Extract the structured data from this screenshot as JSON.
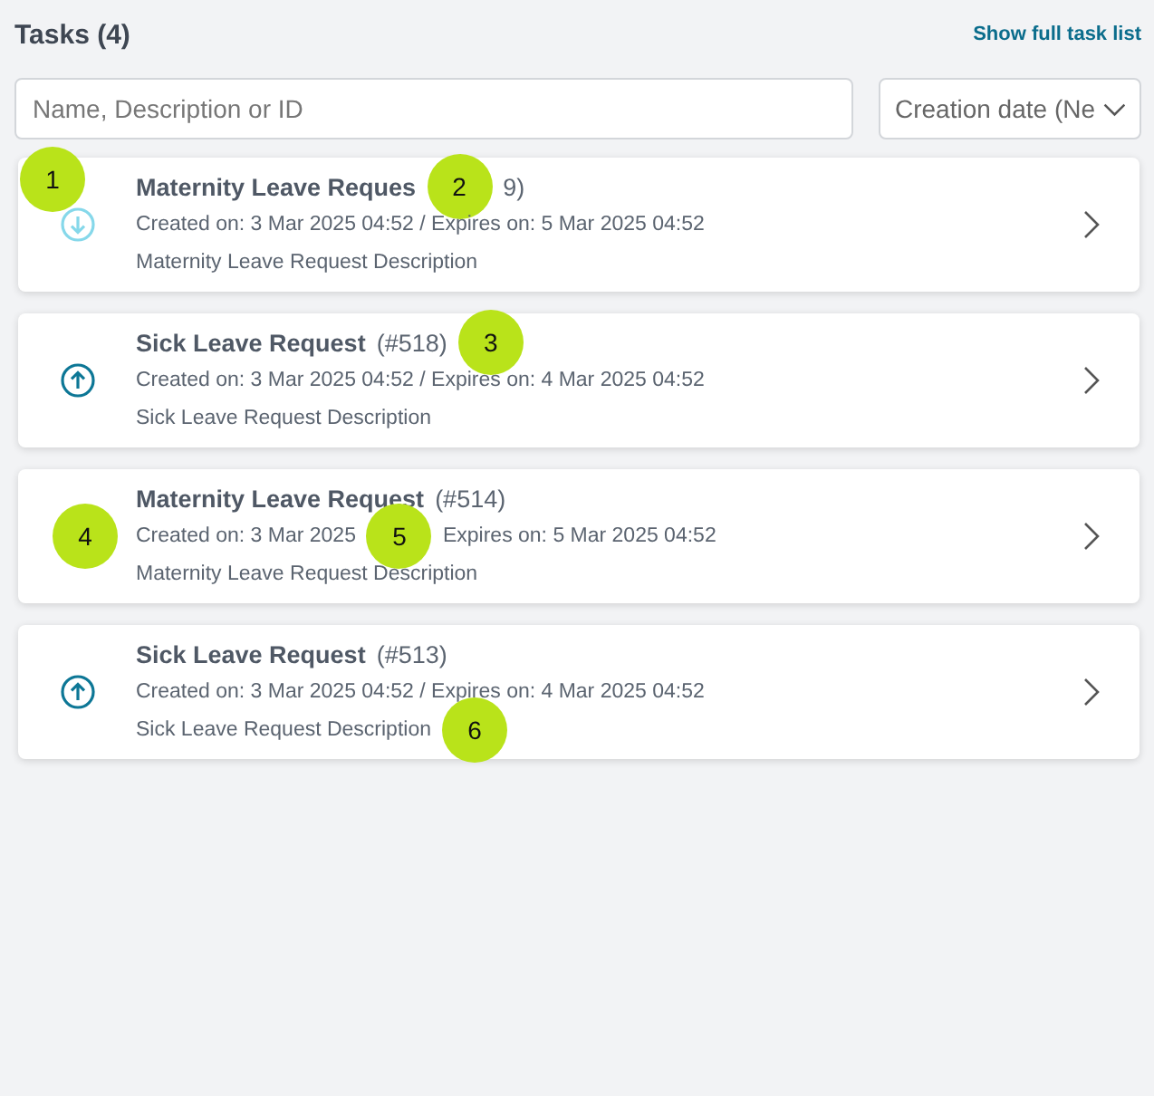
{
  "header": {
    "title": "Tasks (4)",
    "link": "Show full task list"
  },
  "search": {
    "placeholder": "Name, Description or ID"
  },
  "sort": {
    "value": "Creation date (Ne"
  },
  "rows": [
    {
      "kind": "down",
      "icon_callout": "1",
      "title": [
        {
          "kind": "strong",
          "text": "Maternity Leave Reques"
        },
        {
          "kind": "callout",
          "number": "2"
        },
        {
          "kind": "plain",
          "text": "9)"
        }
      ],
      "meta": [
        {
          "kind": "plain",
          "text": "Created on: 3 Mar 2025 04:52 / Expires on: 5 Mar 2025 04:52"
        }
      ],
      "description": [
        {
          "kind": "plain",
          "text": "Maternity Leave Request Description"
        }
      ]
    },
    {
      "kind": "up",
      "title": [
        {
          "kind": "strong",
          "text": "Sick Leave Request"
        },
        {
          "kind": "plain",
          "text": "(#518)"
        },
        {
          "kind": "callout",
          "number": "3"
        }
      ],
      "meta": [
        {
          "kind": "plain",
          "text": "Created on: 3 Mar 2025 04:52 / Expires on: 4 Mar 2025 04:52"
        }
      ],
      "description": [
        {
          "kind": "plain",
          "text": "Sick Leave Request Description"
        }
      ]
    },
    {
      "kind": "none",
      "icon_callout": "4",
      "title": [
        {
          "kind": "strong",
          "text": "Maternity Leave Request"
        },
        {
          "kind": "plain",
          "text": "(#514)"
        }
      ],
      "meta": [
        {
          "kind": "plain",
          "text": "Created on: 3 Mar 2025"
        },
        {
          "kind": "callout",
          "number": "5"
        },
        {
          "kind": "plain",
          "text": "Expires on: 5 Mar 2025 04:52"
        }
      ],
      "description": [
        {
          "kind": "plain",
          "text": "Maternity Leave Request Description"
        }
      ]
    },
    {
      "kind": "up",
      "title": [
        {
          "kind": "strong",
          "text": "Sick Leave Request"
        },
        {
          "kind": "plain",
          "text": "(#513)"
        }
      ],
      "meta": [
        {
          "kind": "plain",
          "text": "Created on: 3 Mar 2025 04:52 / Expires on: 4 Mar 2025 04:52"
        }
      ],
      "description": [
        {
          "kind": "plain",
          "text": "Sick Leave Request Description"
        },
        {
          "kind": "callout",
          "number": "6"
        }
      ]
    }
  ]
}
